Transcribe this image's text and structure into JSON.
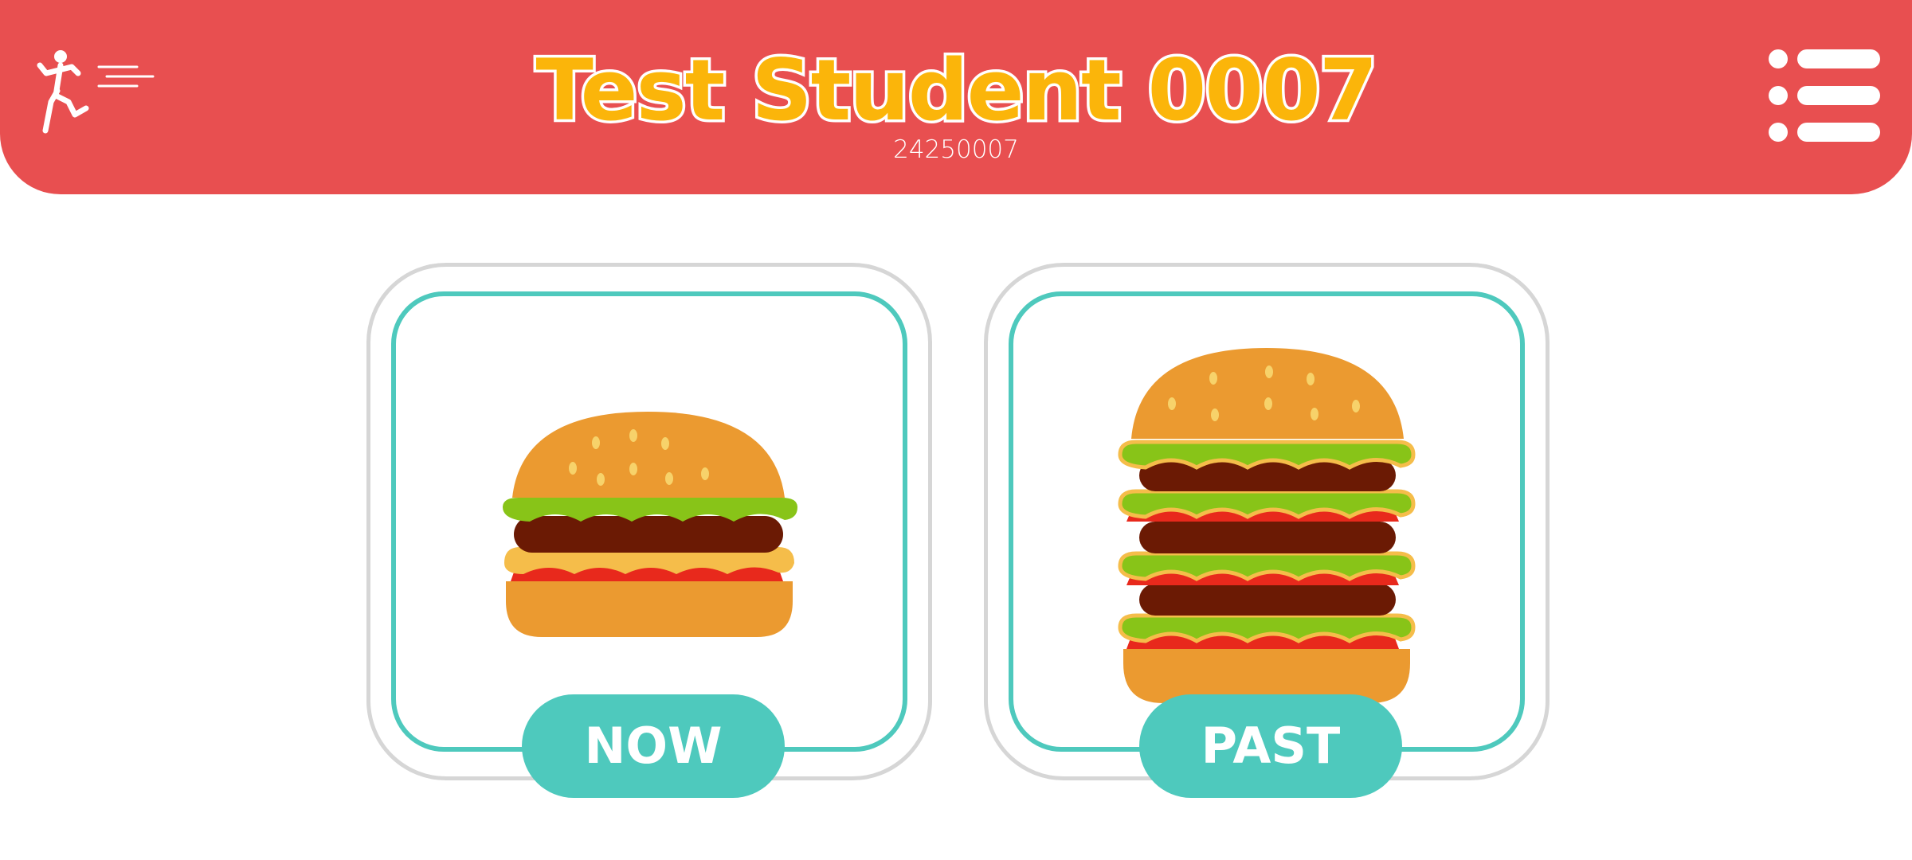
{
  "header": {
    "title": "Test Student 0007",
    "student_id": "24250007",
    "exit_icon": "running-person-icon",
    "menu_icon": "menu-list-icon"
  },
  "cards": [
    {
      "label": "NOW",
      "image": "single-burger-icon"
    },
    {
      "label": "PAST",
      "image": "tall-burger-icon"
    }
  ],
  "colors": {
    "header_bg": "#e84f50",
    "title_fill": "#fbb50a",
    "accent_teal": "#4ec9bd",
    "card_border": "#d6d6d6"
  }
}
